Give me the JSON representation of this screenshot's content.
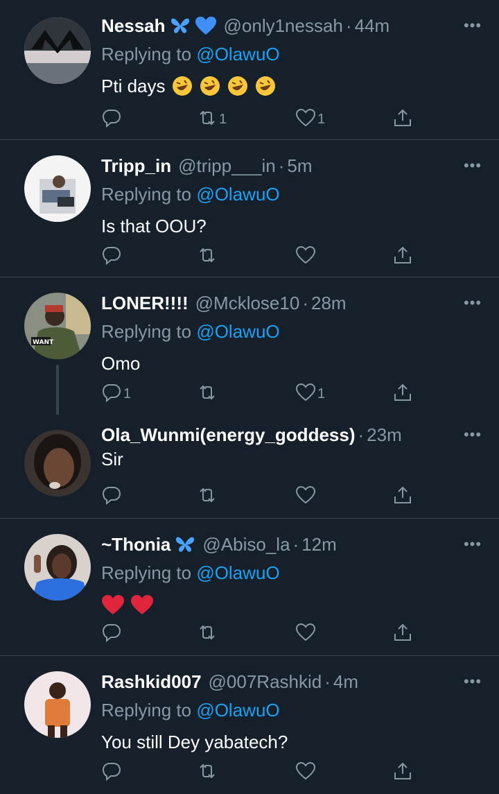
{
  "colors": {
    "background": "#15202b",
    "secondary_text": "#8899a6",
    "link": "#1da1f2",
    "divider": "#38444d"
  },
  "replying_prefix": "Replying to",
  "tweets": [
    {
      "name": "Nessah",
      "name_emojis": [
        "butterfly-icon",
        "blue-heart-icon"
      ],
      "handle": "@only1nessah",
      "time": "44m",
      "mention": "@OlawuO",
      "text": "Pti days",
      "text_emojis": [
        "rofl-emoji",
        "rofl-emoji",
        "rofl-emoji",
        "rofl-emoji"
      ],
      "reply_count": "",
      "retweet_count": "1",
      "like_count": "1"
    },
    {
      "name": "Tripp_in",
      "handle": "@tripp___in",
      "time": "5m",
      "mention": "@OlawuO",
      "text": "Is that OOU?",
      "reply_count": "",
      "retweet_count": "",
      "like_count": ""
    },
    {
      "name": "LONER!!!!",
      "handle": "@Mcklose10",
      "time": "28m",
      "mention": "@OlawuO",
      "text": "Omo",
      "avatar_text": "WANT",
      "reply_count": "1",
      "retweet_count": "",
      "like_count": "1"
    },
    {
      "name": "Ola_Wunmi(energy_goddess)",
      "handle": "",
      "time": "23m",
      "mention": "",
      "text": "Sir",
      "reply_count": "",
      "retweet_count": "",
      "like_count": ""
    },
    {
      "name": "~Thonia",
      "name_emojis": [
        "butterfly-icon"
      ],
      "handle": "@Abiso_la",
      "time": "12m",
      "mention": "@OlawuO",
      "text": "",
      "text_emojis": [
        "red-heart-emoji",
        "red-heart-emoji"
      ],
      "reply_count": "",
      "retweet_count": "",
      "like_count": ""
    },
    {
      "name": "Rashkid007",
      "handle": "@007Rashkid",
      "time": "4m",
      "mention": "@OlawuO",
      "text": "You still Dey yabatech?",
      "reply_count": "",
      "retweet_count": "",
      "like_count": ""
    }
  ]
}
